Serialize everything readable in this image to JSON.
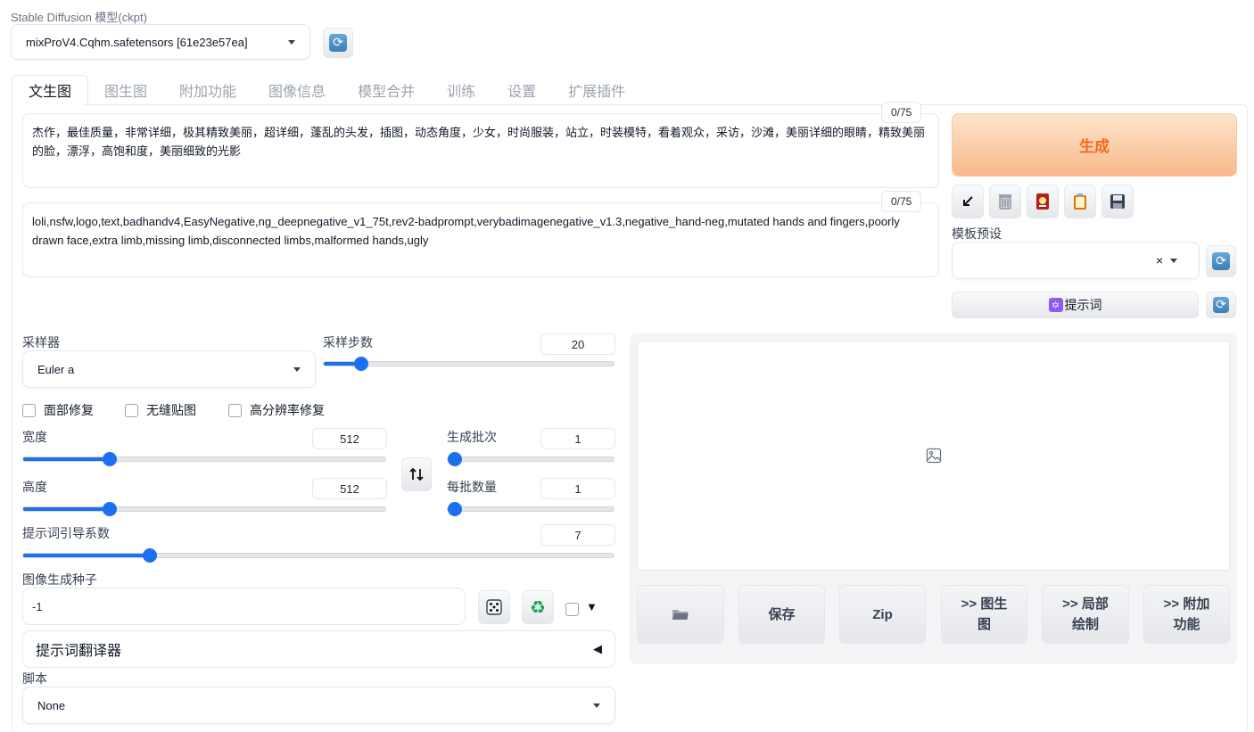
{
  "model": {
    "label": "Stable Diffusion 模型(ckpt)",
    "selected": "mixProV4.Cqhm.safetensors [61e23e57ea]"
  },
  "tabs": [
    "文生图",
    "图生图",
    "附加功能",
    "图像信息",
    "模型合并",
    "训练",
    "设置",
    "扩展插件"
  ],
  "prompt": {
    "counter": "0/75",
    "text": "杰作，最佳质量，非常详细，极其精致美丽，超详细，蓬乱的头发，插图，动态角度，少女，时尚服装，站立，时装模特，看着观众，采访，沙滩，美丽详细的眼睛，精致美丽的脸，漂浮，高饱和度，美丽细致的光影"
  },
  "negative_prompt": {
    "counter": "0/75",
    "text": "loli,nsfw,logo,text,badhandv4,EasyNegative,ng_deepnegative_v1_75t,rev2-badprompt,verybadimagenegative_v1.3,negative_hand-neg,mutated hands and fingers,poorly drawn face,extra limb,missing limb,disconnected limbs,malformed hands,ugly"
  },
  "generate_label": "生成",
  "tool_icons": [
    "arrow-icon",
    "trash-icon",
    "card-icon",
    "clipboard-icon",
    "save-icon"
  ],
  "styles": {
    "label": "模板预设",
    "clear": "×"
  },
  "prompt_button": "提示词",
  "sampler": {
    "label": "采样器",
    "value": "Euler a"
  },
  "steps": {
    "label": "采样步数",
    "value": "20",
    "fraction": 0.13
  },
  "checkboxes": [
    "面部修复",
    "无缝贴图",
    "高分辨率修复"
  ],
  "width": {
    "label": "宽度",
    "value": "512",
    "fraction": 0.24
  },
  "height": {
    "label": "高度",
    "value": "512",
    "fraction": 0.24
  },
  "batch_count": {
    "label": "生成批次",
    "value": "1",
    "fraction": 0.0
  },
  "batch_size": {
    "label": "每批数量",
    "value": "1",
    "fraction": 0.0
  },
  "cfg": {
    "label": "提示词引导系数",
    "value": "7",
    "fraction": 0.215
  },
  "seed": {
    "label": "图像生成种子",
    "value": "-1"
  },
  "translator": {
    "label": "提示词翻译器"
  },
  "script": {
    "label": "脚本",
    "value": "None"
  },
  "output_buttons": {
    "save": "保存",
    "zip": "Zip",
    "to_img2img": ">> 图生图",
    "to_inpaint": ">> 局部绘制",
    "to_extras": ">> 附加功能"
  },
  "colors": {
    "accent": "#1d6ff2",
    "generate_text": "#f26b1d",
    "generate_bg": "#fbd0a6"
  }
}
